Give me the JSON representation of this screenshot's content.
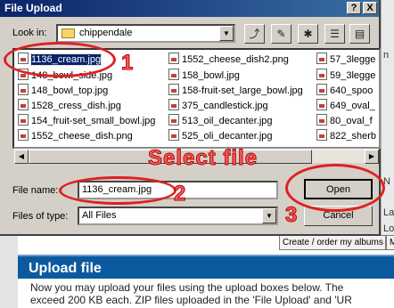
{
  "dialog": {
    "title": "File Upload",
    "help_btn": "?",
    "close_btn": "X",
    "look_in_label": "Look in:",
    "look_in_value": "chippendale",
    "file_name_label": "File name:",
    "file_name_value": "1136_cream.jpg",
    "files_of_type_label": "Files of type:",
    "files_of_type_value": "All Files",
    "open_btn": "Open",
    "cancel_btn": "Cancel",
    "files": [
      "1136_cream.jpg",
      "148_bowl_side.jpg",
      "148_bowl_top.jpg",
      "1528_cress_dish.jpg",
      "154_fruit-set_small_bowl.jpg",
      "1552_cheese_dish.png",
      "1552_cheese_dish2.png",
      "158_bowl.jpg",
      "158-fruit-set_large_bowl.jpg",
      "375_candlestick.jpg",
      "513_oil_decanter.jpg",
      "525_oli_decanter.jpg",
      "57_3legge",
      "59_3legge",
      "640_spoo",
      "649_oval_",
      "80_oval_f",
      "822_sherb"
    ],
    "selected_file": "1136_cream.jpg"
  },
  "annotations": {
    "step1": "1",
    "step2": "2",
    "step3": "3",
    "select_file": "Select file",
    "color": "#e02020"
  },
  "background": {
    "tabs": [
      "Create / order my albums",
      "Ma"
    ],
    "upload_title": "Upload file",
    "desc_line1": "Now you may upload your files using the upload boxes below. The",
    "desc_line2": "exceed 200 KB each. ZIP files uploaded in the 'File Upload' and 'UR",
    "right_fragments": [
      "n",
      "",
      "N",
      "La",
      "Lo"
    ],
    "header_color": "#0b5aa0"
  }
}
